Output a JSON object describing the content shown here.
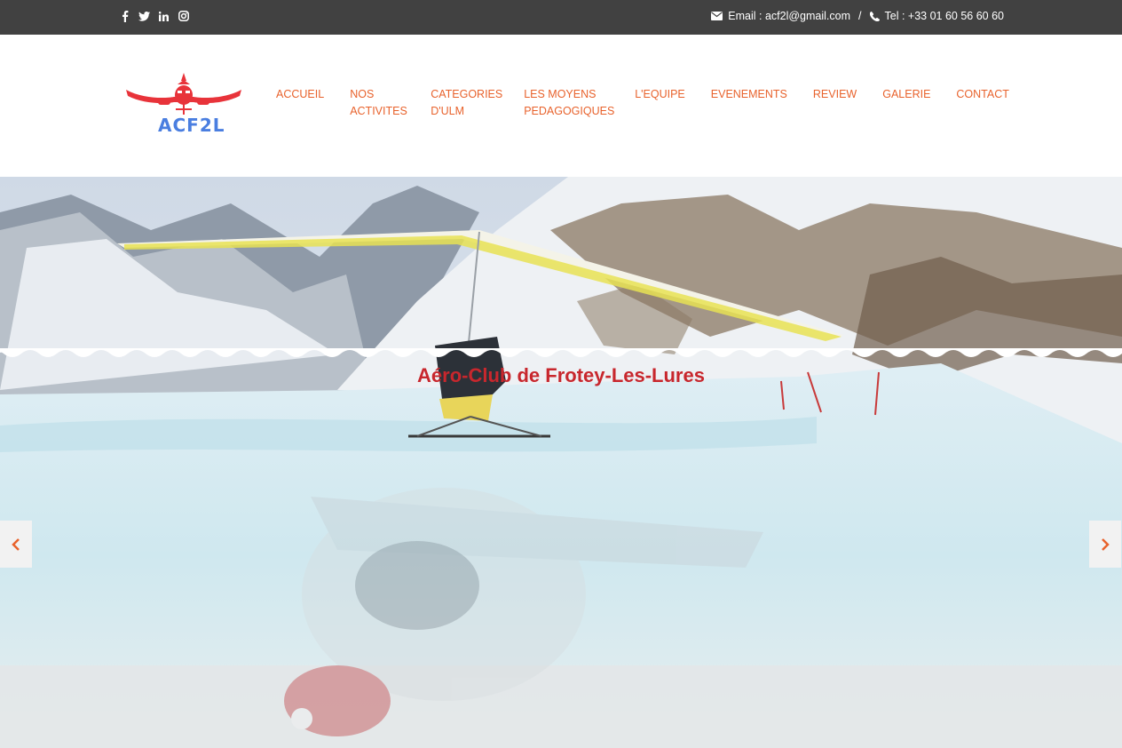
{
  "topbar": {
    "social_icons": [
      "facebook-icon",
      "twitter-icon",
      "linkedin-icon",
      "instagram-icon"
    ],
    "email_text": "Email : acf2l@gmail.com",
    "separator": "/",
    "phone_text": "Tel : +33 01 60 56 60 60"
  },
  "logo": {
    "text": "ACF2L"
  },
  "nav": {
    "items": [
      "ACCUEIL",
      "NOS\nACTIVITES",
      "CATEGORIES\nD'ULM",
      "LES MOYENS\nPEDAGOGIQUES",
      "L'EQUIPE",
      "EVENEMENTS",
      "REVIEW",
      "GALERIE",
      "CONTACT"
    ]
  },
  "hero": {
    "title": "Aéro-Club de Frotey-Les-Lures",
    "prev_icon": "chevron-left-icon",
    "next_icon": "chevron-right-icon"
  },
  "colors": {
    "topbar_bg": "#414141",
    "nav_link": "#e8622c",
    "hero_title": "#c8272d",
    "logo_red": "#e8333a",
    "logo_blue": "#4a7ee0"
  }
}
